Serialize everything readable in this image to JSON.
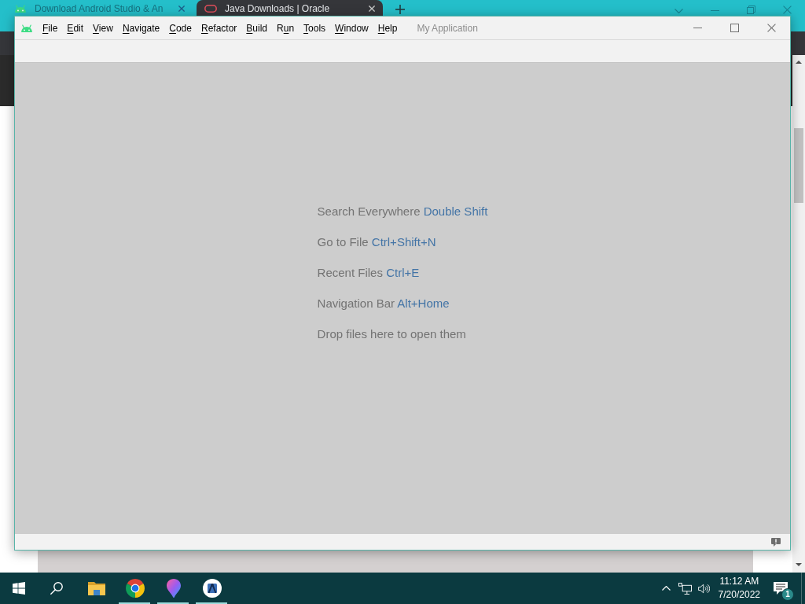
{
  "browser": {
    "tabs": [
      {
        "kind": "robot",
        "title": "Download Android Studio & An",
        "selected": false
      },
      {
        "kind": "ring",
        "title": "Java Downloads | Oracle",
        "selected": true
      }
    ]
  },
  "ide": {
    "menu": [
      {
        "key": "F",
        "after": "ile"
      },
      {
        "key": "E",
        "after": "dit"
      },
      {
        "key": "V",
        "after": "iew"
      },
      {
        "key": "N",
        "after": "avigate"
      },
      {
        "key": "C",
        "after": "ode"
      },
      {
        "key": "R",
        "after": "efactor"
      },
      {
        "key": "B",
        "after": "uild"
      },
      {
        "before": "R",
        "key": "u",
        "after": "n"
      },
      {
        "key": "T",
        "after": "ools"
      },
      {
        "key": "W",
        "after": "indow"
      },
      {
        "key": "H",
        "after": "elp"
      }
    ],
    "project": "My Application",
    "hints": [
      {
        "text": "Search Everywhere",
        "shortcut": "Double Shift"
      },
      {
        "text": "Go to File",
        "shortcut": "Ctrl+Shift+N"
      },
      {
        "text": "Recent Files",
        "shortcut": "Ctrl+E"
      },
      {
        "text": "Navigation Bar",
        "shortcut": "Alt+Home"
      },
      {
        "text": "Drop files here to open them"
      }
    ]
  },
  "taskbar": {
    "apps": [
      {
        "kind": "folder",
        "running": false
      },
      {
        "kind": "browser",
        "running": true
      },
      {
        "kind": "balloon",
        "running": true
      },
      {
        "kind": "studio",
        "running": true
      }
    ],
    "tray": {
      "time": "11:12 AM",
      "date": "7/20/2022",
      "notifications": "1"
    }
  }
}
